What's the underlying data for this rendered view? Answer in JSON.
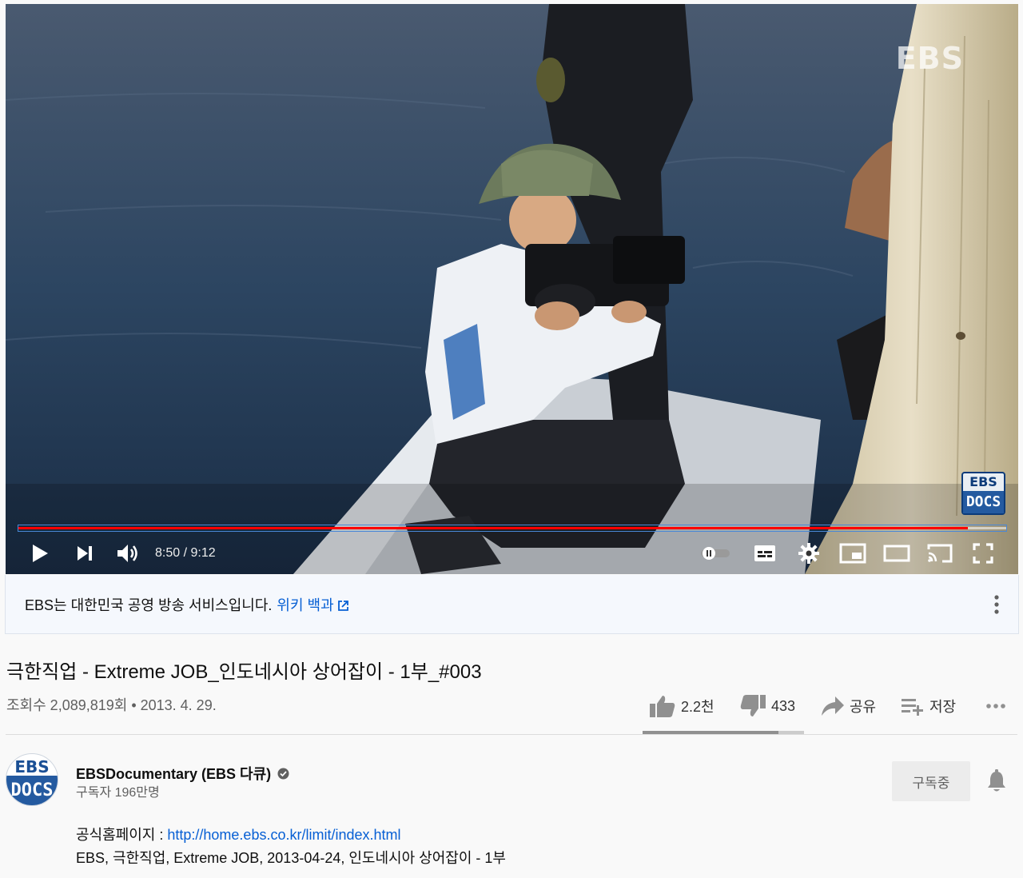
{
  "player": {
    "watermark": "EBS",
    "badge_top": "EBS",
    "badge_bottom": "DOCS",
    "current_time": "8:50",
    "duration": "9:12",
    "time_display": "8:50 / 9:12",
    "progress_fraction": 0.961,
    "accent_color": "#ff0000",
    "icons": [
      "play-icon",
      "next-icon",
      "volume-icon",
      "autoplay-toggle-icon",
      "captions-icon",
      "settings-icon",
      "miniplayer-icon",
      "theater-icon",
      "cast-icon",
      "fullscreen-icon"
    ]
  },
  "info_panel": {
    "text": "EBS는 대한민국 공영 방송 서비스입니다.",
    "link": "위키 백과",
    "icons": [
      "external-link-icon",
      "more-vert-icon"
    ]
  },
  "video": {
    "title": "극한직업 - Extreme JOB_인도네시아 상어잡이 - 1부_#003",
    "meta": "조회수 2,089,819회 • 2013. 4. 29.",
    "likes": "2.2천",
    "dislikes": "433",
    "share": "공유",
    "save": "저장",
    "like_fraction": 0.84
  },
  "channel": {
    "avatar_top": "EBS",
    "avatar_bottom": "DOCS",
    "name": "EBSDocumentary (EBS 다큐)",
    "subscribers": "구독자 196만명",
    "subscribe_label": "구독중"
  },
  "description": {
    "homepage_label": "공식홈페이지 : ",
    "homepage_url": "http://home.ebs.co.kr/limit/index.html",
    "line2": "EBS, 극한직업, Extreme JOB, 2013-04-24, 인도네시아 상어잡이 - 1부"
  }
}
